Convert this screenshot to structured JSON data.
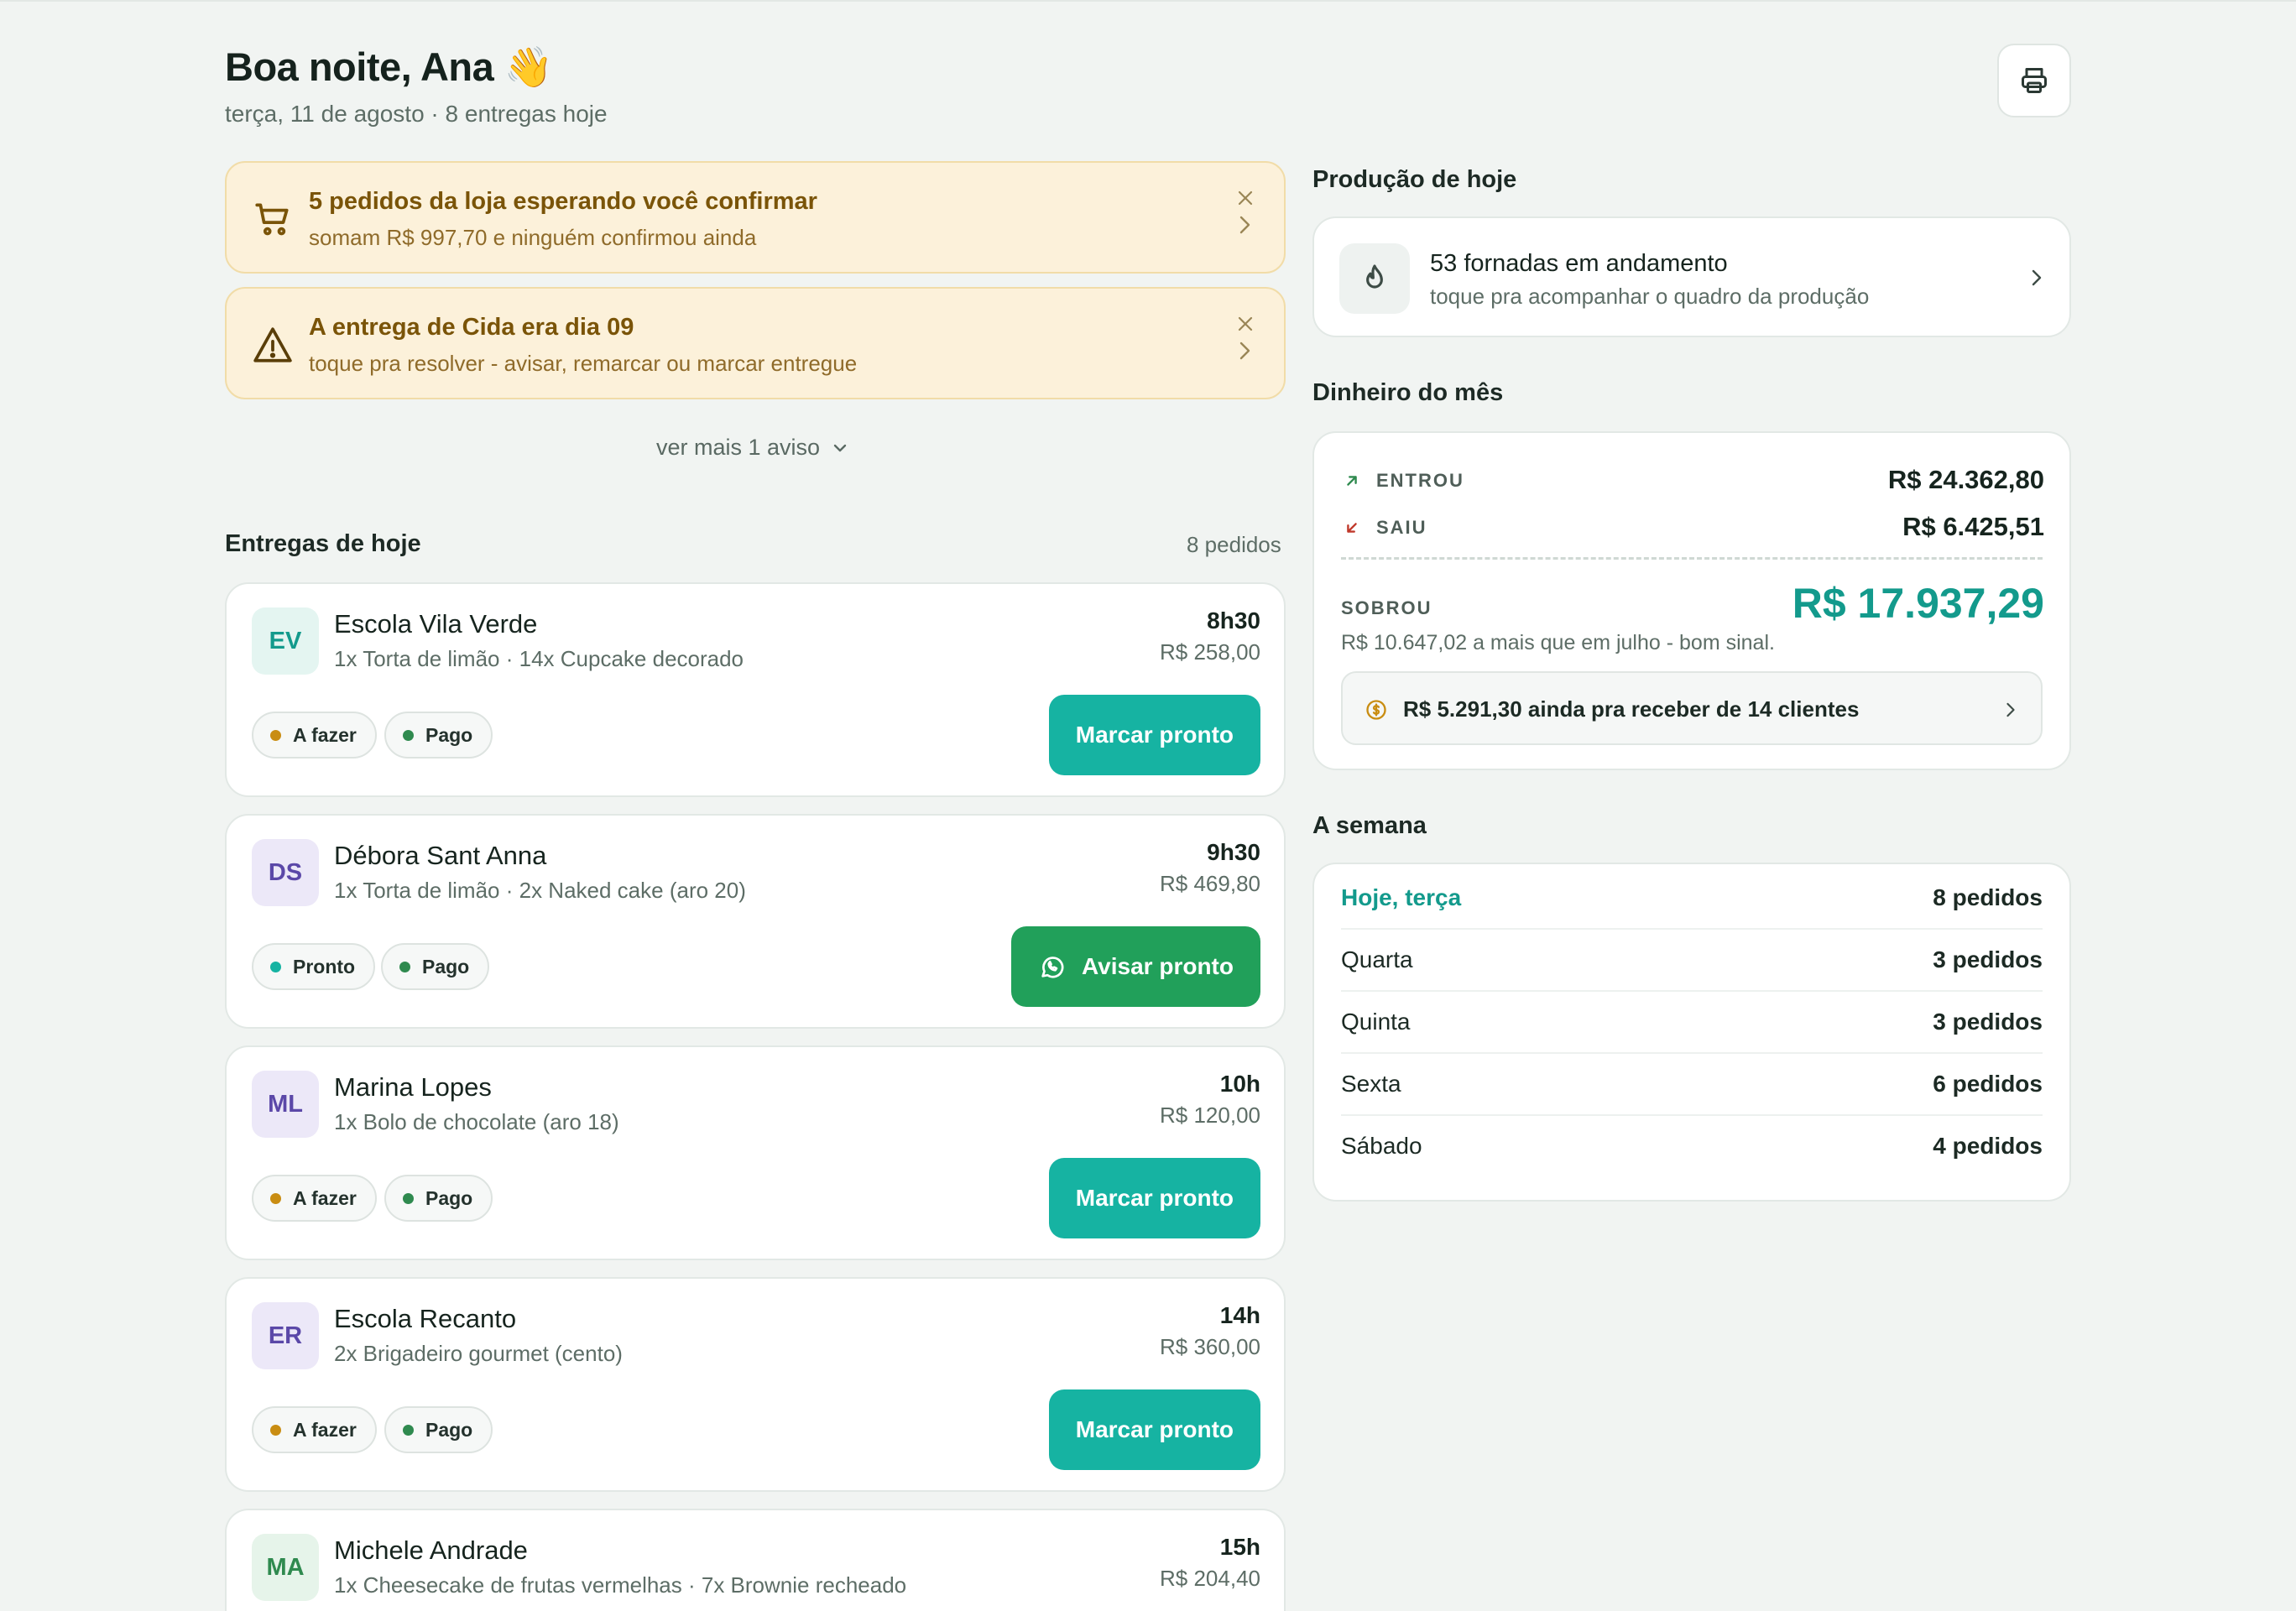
{
  "header": {
    "greeting": "Boa noite, Ana 👋",
    "date_line": "terça, 11 de agosto · 8 entregas hoje"
  },
  "alerts": [
    {
      "icon": "cart-icon",
      "title": "5 pedidos da loja esperando você confirmar",
      "subtitle": "somam R$ 997,70 e ninguém confirmou ainda"
    },
    {
      "icon": "warning-icon",
      "title": "A entrega de Cida era dia 09",
      "subtitle": "toque pra resolver - avisar, remarcar ou marcar entregue"
    }
  ],
  "see_more": "ver mais 1 aviso",
  "deliveries": {
    "title": "Entregas de hoje",
    "count": "8 pedidos",
    "items": [
      {
        "initials": "EV",
        "name": "Escola Vila Verde",
        "items": "1x Torta de limão · 14x Cupcake decorado",
        "time": "8h30",
        "price": "R$ 258,00",
        "status": "A fazer",
        "payment": "Pago",
        "action": "Marcar pronto",
        "avatar_bg": "#e4f5f1",
        "avatar_fg": "#139a8c",
        "status_color": "#c98d12"
      },
      {
        "initials": "DS",
        "name": "Débora Sant Anna",
        "items": "1x Torta de limão · 2x Naked cake (aro 20)",
        "time": "9h30",
        "price": "R$ 469,80",
        "status": "Pronto",
        "payment": "Pago",
        "action": "Avisar pronto",
        "avatar_bg": "#ece8f8",
        "avatar_fg": "#5b48a8",
        "status_color": "#16b3a2"
      },
      {
        "initials": "ML",
        "name": "Marina Lopes",
        "items": "1x Bolo de chocolate (aro 18)",
        "time": "10h",
        "price": "R$ 120,00",
        "status": "A fazer",
        "payment": "Pago",
        "action": "Marcar pronto",
        "avatar_bg": "#ece8f8",
        "avatar_fg": "#5b48a8",
        "status_color": "#c98d12"
      },
      {
        "initials": "ER",
        "name": "Escola Recanto",
        "items": "2x Brigadeiro gourmet (cento)",
        "time": "14h",
        "price": "R$ 360,00",
        "status": "A fazer",
        "payment": "Pago",
        "action": "Marcar pronto",
        "avatar_bg": "#ece8f8",
        "avatar_fg": "#5b48a8",
        "status_color": "#c98d12"
      },
      {
        "initials": "MA",
        "name": "Michele Andrade",
        "items": "1x Cheesecake de frutas vermelhas · 7x Brownie recheado",
        "time": "15h",
        "price": "R$ 204,40",
        "avatar_bg": "#e6f4ea",
        "avatar_fg": "#2f8a4f"
      }
    ]
  },
  "production": {
    "title": "Produção de hoje",
    "card_title": "53 fornadas em andamento",
    "card_sub": "toque pra acompanhar o quadro da produção"
  },
  "money": {
    "title": "Dinheiro do mês",
    "in_label": "ENTROU",
    "in_value": "R$ 24.362,80",
    "out_label": "SAIU",
    "out_value": "R$ 6.425,51",
    "left_label": "SOBROU",
    "left_value": "R$ 17.937,29",
    "note": "R$ 10.647,02 a mais que em julho - bom sinal.",
    "receivable": "R$ 5.291,30 ainda pra receber de 14 clientes"
  },
  "week": {
    "title": "A semana",
    "days": [
      {
        "day": "Hoje, terça",
        "count": "8 pedidos"
      },
      {
        "day": "Quarta",
        "count": "3 pedidos"
      },
      {
        "day": "Quinta",
        "count": "3 pedidos"
      },
      {
        "day": "Sexta",
        "count": "6 pedidos"
      },
      {
        "day": "Sábado",
        "count": "4 pedidos"
      }
    ]
  },
  "colors": {
    "accent": "#16b3a2",
    "whatsapp": "#21a05a",
    "alert_bg": "#fcf1da",
    "paid_dot": "#2f8a4f"
  }
}
